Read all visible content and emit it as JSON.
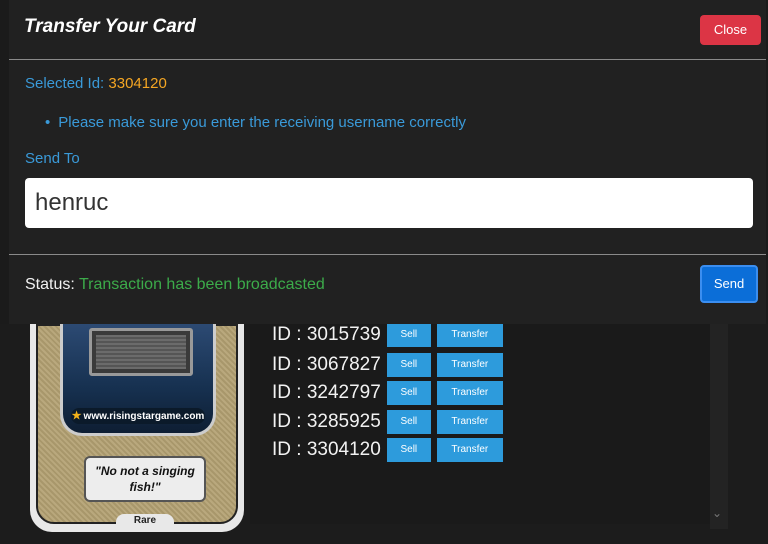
{
  "modal": {
    "title": "Transfer Your Card",
    "close_label": "Close",
    "selected_label": "Selected Id:",
    "selected_value": "3304120",
    "note": "Please make sure you enter the receiving username correctly",
    "send_to_label": "Send To",
    "username_value": "henruc",
    "status_label": "Status:",
    "status_value": "Transaction has been broadcasted",
    "send_label": "Send"
  },
  "card": {
    "url": "www.risingstargame.com",
    "quote": "\"No not a singing fish!\"",
    "rarity": "Rare"
  },
  "list": {
    "rows": [
      {
        "id": "ID : 3015739",
        "sell": "Sell",
        "transfer": "Transfer"
      },
      {
        "id": "ID : 3067827",
        "sell": "Sell",
        "transfer": "Transfer"
      },
      {
        "id": "ID : 3242797",
        "sell": "Sell",
        "transfer": "Transfer"
      },
      {
        "id": "ID : 3285925",
        "sell": "Sell",
        "transfer": "Transfer"
      },
      {
        "id": "ID : 3304120",
        "sell": "Sell",
        "transfer": "Transfer"
      }
    ]
  },
  "colors": {
    "accent_blue": "#3a9ad9",
    "selected_orange": "#f5a623",
    "status_green": "#3cab4a",
    "close_red": "#dc3545",
    "send_blue": "#0b6ed8",
    "list_button_blue": "#2d9bdc"
  }
}
